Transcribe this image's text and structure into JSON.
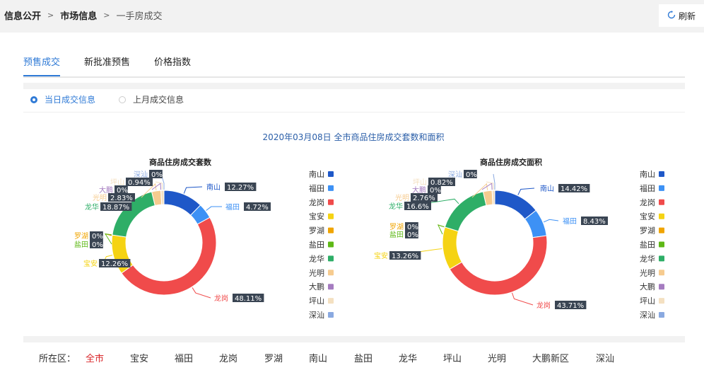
{
  "breadcrumb": {
    "item1": "信息公开",
    "item2": "市场信息",
    "item3": "一手房成交"
  },
  "refresh_label": "刷新",
  "tabs": [
    {
      "label": "预售成交",
      "active": true
    },
    {
      "label": "新批准预售",
      "active": false
    },
    {
      "label": "价格指数",
      "active": false
    }
  ],
  "radios": [
    {
      "label": "当日成交信息",
      "checked": true
    },
    {
      "label": "上月成交信息",
      "checked": false
    }
  ],
  "main_title": "2020年03月08日 全市商品住房成交套数和面积",
  "colors": {
    "南山": "#1f58c8",
    "福田": "#3d91f5",
    "龙岗": "#f04b4b",
    "宝安": "#f5d313",
    "罗湖": "#f0a400",
    "盐田": "#5eb816",
    "龙华": "#2eae67",
    "光明": "#f6cb8f",
    "大鹏": "#a57cc0",
    "坪山": "#f4e0c1",
    "深汕": "#8aa9e0"
  },
  "chart_data": [
    {
      "type": "pie",
      "title": "商品住房成交套数",
      "categories": [
        "南山",
        "福田",
        "龙岗",
        "宝安",
        "罗湖",
        "盐田",
        "龙华",
        "光明",
        "大鹏",
        "坪山",
        "深汕"
      ],
      "values": [
        12.27,
        4.72,
        48.11,
        12.26,
        0,
        0,
        18.87,
        2.83,
        0,
        0.94,
        0
      ],
      "labels": [
        "12.27%",
        "4.72%",
        "48.11%",
        "12.26%",
        "0%",
        "0%",
        "18.87%",
        "2.83%",
        "0%",
        "0.94%",
        "0%"
      ],
      "legend": "right"
    },
    {
      "type": "pie",
      "title": "商品住房成交面积",
      "categories": [
        "南山",
        "福田",
        "龙岗",
        "宝安",
        "罗湖",
        "盐田",
        "龙华",
        "光明",
        "大鹏",
        "坪山",
        "深汕"
      ],
      "values": [
        14.42,
        8.43,
        43.71,
        13.26,
        0,
        0,
        16.6,
        2.76,
        0,
        0.82,
        0
      ],
      "labels": [
        "14.42%",
        "8.43%",
        "43.71%",
        "13.26%",
        "0%",
        "0%",
        "16.6%",
        "2.76%",
        "0%",
        "0.82%",
        "0%"
      ],
      "legend": "right"
    }
  ],
  "district_filter": {
    "label": "所在区：",
    "items": [
      "全市",
      "宝安",
      "福田",
      "龙岗",
      "罗湖",
      "南山",
      "盐田",
      "龙华",
      "坪山",
      "光明",
      "大鹏新区",
      "深汕"
    ],
    "selected": "全市"
  }
}
